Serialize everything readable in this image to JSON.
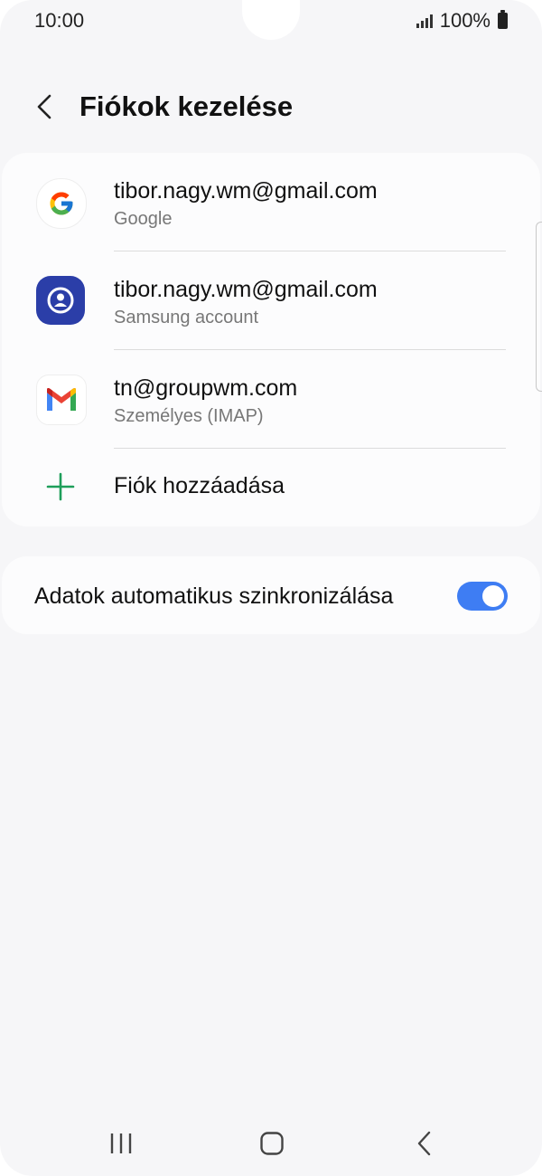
{
  "status_bar": {
    "time": "10:00",
    "battery": "100%"
  },
  "header": {
    "title": "Fiókok kezelése"
  },
  "accounts": [
    {
      "email": "tibor.nagy.wm@gmail.com",
      "type": "Google",
      "icon": "google-icon"
    },
    {
      "email": "tibor.nagy.wm@gmail.com",
      "type": "Samsung account",
      "icon": "samsung-account-icon"
    },
    {
      "email": "tn@groupwm.com",
      "type": "Személyes (IMAP)",
      "icon": "gmail-icon"
    }
  ],
  "add_account": {
    "label": "Fiók hozzáadása"
  },
  "sync": {
    "label": "Adatok automatikus szinkronizálása",
    "enabled": true
  },
  "colors": {
    "accent": "#3e7df3",
    "plus": "#1e9e5a",
    "samsung_blue": "#2b3ea8"
  },
  "nav_bar": {
    "icons": [
      "recent-apps-icon",
      "home-icon",
      "back-icon"
    ]
  }
}
